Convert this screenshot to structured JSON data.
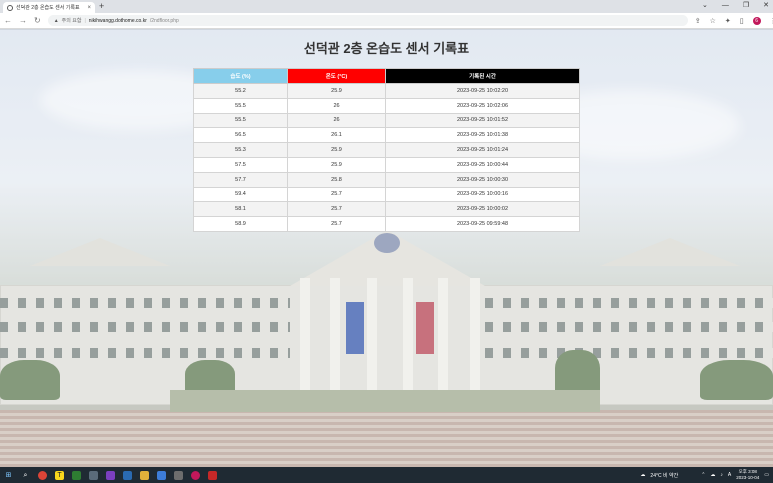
{
  "browser": {
    "tab_title": "선덕관 2층 온습도 센서 기록표",
    "tab_close": "×",
    "new_tab": "+",
    "window_controls": [
      "⌄",
      "—",
      "❐",
      "✕"
    ],
    "nav": {
      "back": "←",
      "forward": "→",
      "reload": "↻"
    },
    "address": {
      "security_label": "주의 요함",
      "separator": "|",
      "host": "nikihwangg.dothome.co.kr",
      "path": "/2ndfloor.php"
    },
    "toolbar_icons": [
      "share-icon",
      "star-icon",
      "extensions-icon",
      "sidebar-icon",
      "profile-icon",
      "menu-icon"
    ],
    "profile_initial": "6"
  },
  "page": {
    "title": "선덕관 2층 온습도 센서 기록표"
  },
  "table": {
    "headers": [
      {
        "label": "습도 (%)",
        "color": "#87ceeb"
      },
      {
        "label": "온도 (°C)",
        "color": "#ff0000"
      },
      {
        "label": "기록된 시간",
        "color": "#000000"
      }
    ],
    "rows": [
      [
        "55.2",
        "25.9",
        "2023-09-25 10:02:20"
      ],
      [
        "55.5",
        "26",
        "2023-09-25 10:02:06"
      ],
      [
        "55.5",
        "26",
        "2023-09-25 10:01:52"
      ],
      [
        "56.5",
        "26.1",
        "2023-09-25 10:01:38"
      ],
      [
        "55.3",
        "25.9",
        "2023-09-25 10:01:24"
      ],
      [
        "57.5",
        "25.9",
        "2023-09-25 10:00:44"
      ],
      [
        "57.7",
        "25.8",
        "2023-09-25 10:00:30"
      ],
      [
        "59.4",
        "25.7",
        "2023-09-25 10:00:16"
      ],
      [
        "58.1",
        "25.7",
        "2023-09-25 10:00:02"
      ],
      [
        "58.9",
        "25.7",
        "2023-09-25 09:59:48"
      ]
    ]
  },
  "taskbar": {
    "weather": "24°C 비 약간",
    "tray_icons": [
      "⌃",
      "☁",
      "♪",
      "A"
    ],
    "time": "오후 3:08",
    "date": "2023-10-04"
  }
}
